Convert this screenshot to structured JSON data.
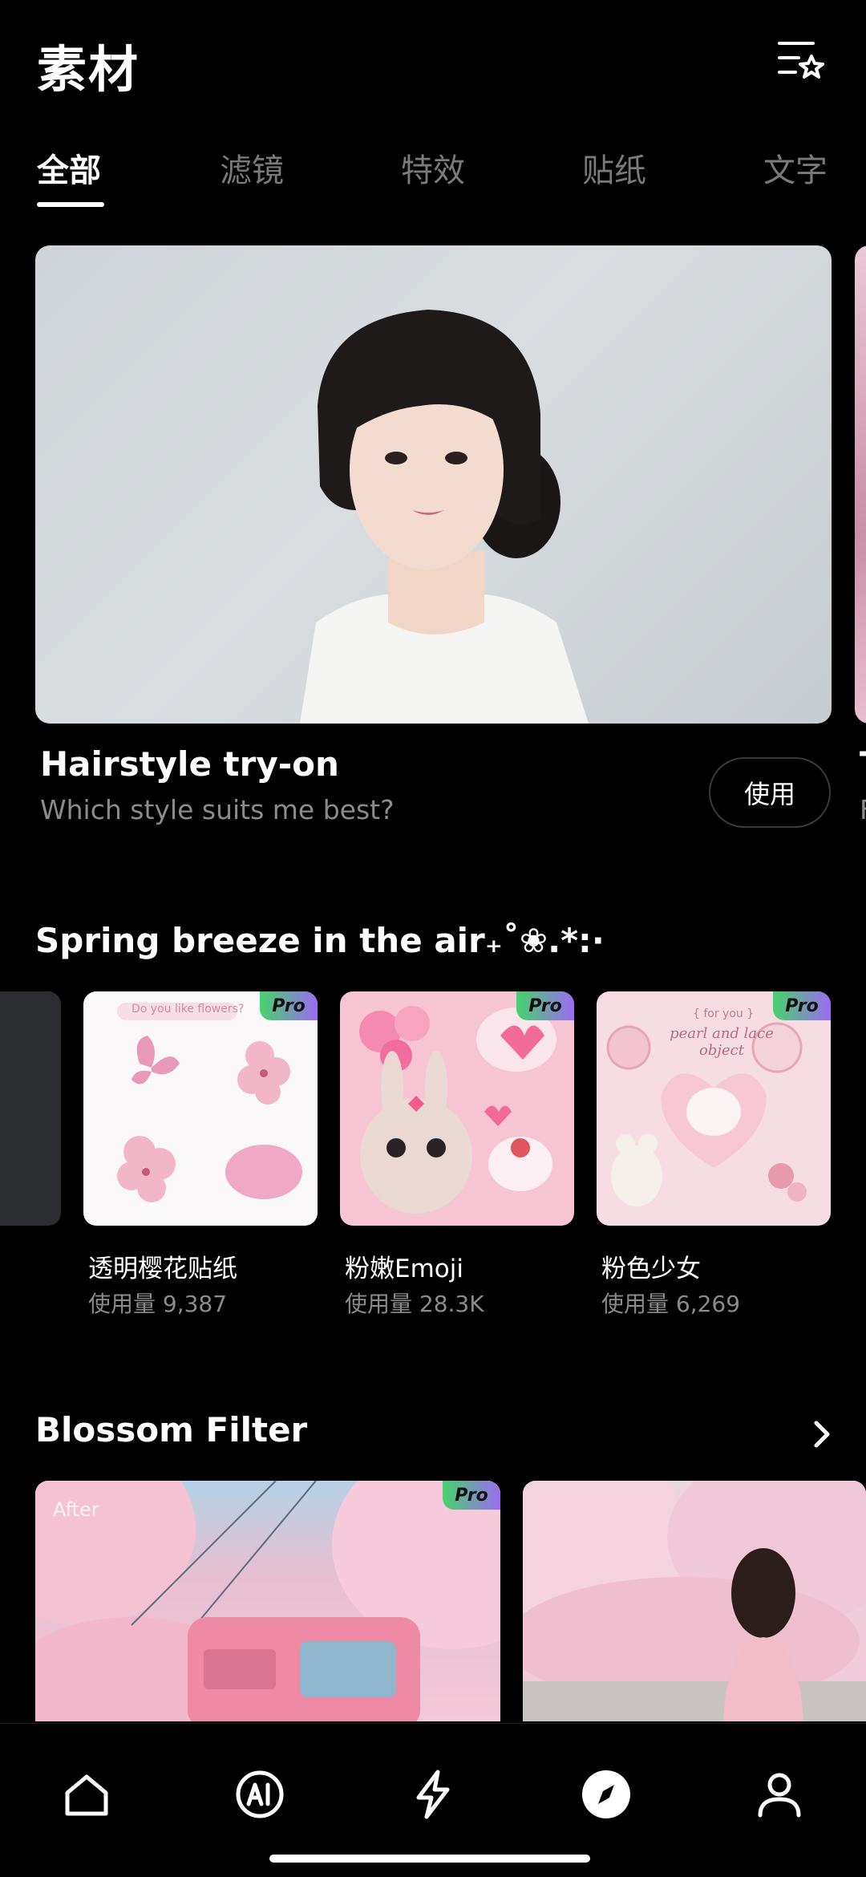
{
  "header": {
    "title": "素材",
    "favorites_icon": "list-star-icon"
  },
  "tabs": [
    {
      "label": "全部",
      "active": true
    },
    {
      "label": "滤镜",
      "active": false
    },
    {
      "label": "特效",
      "active": false
    },
    {
      "label": "贴纸",
      "active": false
    },
    {
      "label": "文字",
      "active": false
    }
  ],
  "hero": {
    "title": "Hairstyle try-on",
    "subtitle": "Which style suits me best?",
    "use_label": "使用",
    "next_title": "T",
    "next_subtitle": "F"
  },
  "sticker_section": {
    "title": "Spring breeze in the air₊˚❀.*:·",
    "pro_label": "Pro",
    "items": [
      {
        "name": "透明樱花贴纸",
        "usage": "使用量 9,387",
        "header_text": "Do you like flowers?"
      },
      {
        "name": "粉嫩Emoji",
        "usage": "使用量 28.3K"
      },
      {
        "name": "粉色少女",
        "usage": "使用量 6,269",
        "header_text": "{ for you }",
        "caption": "pearl and lace object"
      }
    ]
  },
  "filter_section": {
    "title": "Blossom Filter",
    "more_icon": "chevron-right-icon",
    "after_label": "After",
    "pro_label": "Pro"
  },
  "bottom_nav": [
    {
      "icon": "home-icon",
      "active": false
    },
    {
      "icon": "ai-icon",
      "active": false
    },
    {
      "icon": "lightning-icon",
      "active": false
    },
    {
      "icon": "compass-icon",
      "active": true
    },
    {
      "icon": "profile-icon",
      "active": false
    }
  ],
  "colors": {
    "background": "#000000",
    "text_secondary": "#8b8b8b",
    "pro_gradient_start": "#47d36d",
    "pro_gradient_end": "#9b6bf0"
  }
}
